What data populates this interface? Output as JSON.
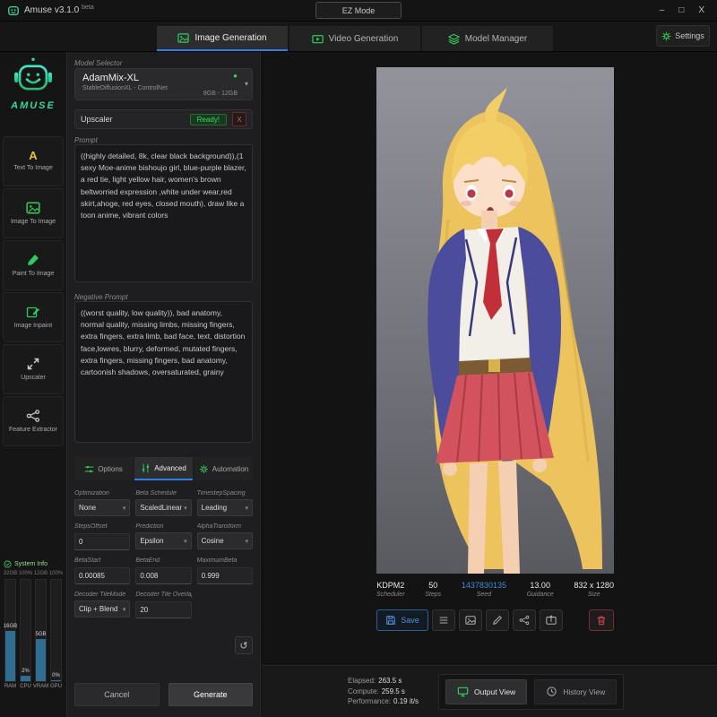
{
  "icons": {
    "chevron_down": "▾",
    "check": "✓",
    "reset": "↺",
    "status_dot": "●",
    "text_to_image_glyph": "A"
  },
  "colors": {
    "accent_green": "#2ecc5b",
    "accent_teal": "#35d9a0",
    "accent_blue": "#2f7fe8",
    "accent_red": "#d24444",
    "seed_link_blue": "#3f8cd6",
    "meter_fill_blue": "#2f6e91"
  },
  "titlebar": {
    "app_title": "Amuse v3.1.0",
    "beta": "beta",
    "ez_mode_label": "EZ Mode",
    "minimize": "–",
    "maximize": "□",
    "close": "X"
  },
  "topnav": {
    "tabs": [
      {
        "label": "Image Generation"
      },
      {
        "label": "Video Generation"
      },
      {
        "label": "Model Manager"
      }
    ],
    "settings_label": "Settings"
  },
  "sidebar": {
    "brand": "AMUSE",
    "items": [
      {
        "label": "Text To Image"
      },
      {
        "label": "Image To Image"
      },
      {
        "label": "Paint To Image"
      },
      {
        "label": "Image Inpaint"
      },
      {
        "label": "Upscaler"
      },
      {
        "label": "Feature Extractor"
      }
    ],
    "system_info": {
      "title": "System Info",
      "scale": [
        "32GB",
        "100%",
        "12GB",
        "100%"
      ],
      "meters": [
        {
          "value": "16GB",
          "label": "RAM",
          "percent": 50
        },
        {
          "value": "2%",
          "label": "CPU",
          "percent": 5
        },
        {
          "value": "5GB",
          "label": "VRAM",
          "percent": 42
        },
        {
          "value": "0%",
          "label": "GPU",
          "percent": 1
        }
      ]
    }
  },
  "panel": {
    "model_selector_label": "Model Selector",
    "model_name": "AdamMix-XL",
    "model_subtitle": "StableDiffusionXL - ControlNet",
    "model_size": "8GB - 12GB",
    "upscaler_label": "Upscaler",
    "upscaler_status": "Ready!",
    "upscaler_clear": "X",
    "prompt_label": "Prompt",
    "prompt_value": "((highly detailed, 8k, clear black background)),(1 sexy Moe-anime bishoujo girl, blue-purple blazer, a red tie, light yellow hair, women's brown beltworried expression ,white under wear,red skirt,ahoge, red eyes, closed mouth), draw like a toon anime, vibrant colors",
    "negative_prompt_label": "Negative Prompt",
    "negative_prompt_value": "((worst quality, low quality)), bad anatomy, normal quality, missing limbs, missing fingers, extra fingers, extra limb, bad face, text, distortion face,lowres, blurry, deformed, mutated fingers, extra fingers, missing fingers, bad anatomy, cartoonish shadows, oversaturated, grainy",
    "tabs": [
      {
        "label": "Options"
      },
      {
        "label": "Advanced"
      },
      {
        "label": "Automation"
      }
    ],
    "fields": {
      "optimization": {
        "label": "Optimization",
        "value": "None"
      },
      "beta_schedule": {
        "label": "Beta Schedule",
        "value": "ScaledLinear"
      },
      "timestep_spacing": {
        "label": "TimestepSpacing",
        "value": "Leading"
      },
      "steps_offset": {
        "label": "StepsOffset",
        "value": "0"
      },
      "prediction": {
        "label": "Prediction",
        "value": "Epsilon"
      },
      "alpha_transform": {
        "label": "AlphaTransform",
        "value": "Cosine"
      },
      "beta_start": {
        "label": "BetaStart",
        "value": "0.00085"
      },
      "beta_end": {
        "label": "BetaEnd",
        "value": "0.008"
      },
      "maximum_beta": {
        "label": "MaximumBeta",
        "value": "0.999"
      },
      "decoder_tile_mode": {
        "label": "Decoder TileMode",
        "value": "Clip + Blend"
      },
      "decoder_tile_overlap": {
        "label": "Decoder Tile Overlap",
        "value": "20"
      }
    },
    "cancel_label": "Cancel",
    "generate_label": "Generate"
  },
  "output": {
    "info": [
      {
        "value": "KDPM2",
        "label": "Scheduler"
      },
      {
        "value": "50",
        "label": "Steps"
      },
      {
        "value": "1437830135",
        "label": "Seed"
      },
      {
        "value": "13.00",
        "label": "Guidance"
      },
      {
        "value": "832 x 1280",
        "label": "Size"
      }
    ],
    "save_label": "Save",
    "stats": [
      {
        "label": "Elapsed:",
        "value": "263.5 s"
      },
      {
        "label": "Compute:",
        "value": "259.5 s"
      },
      {
        "label": "Performance:",
        "value": "0.19 it/s"
      }
    ],
    "views": [
      {
        "label": "Output View"
      },
      {
        "label": "History View"
      }
    ]
  }
}
